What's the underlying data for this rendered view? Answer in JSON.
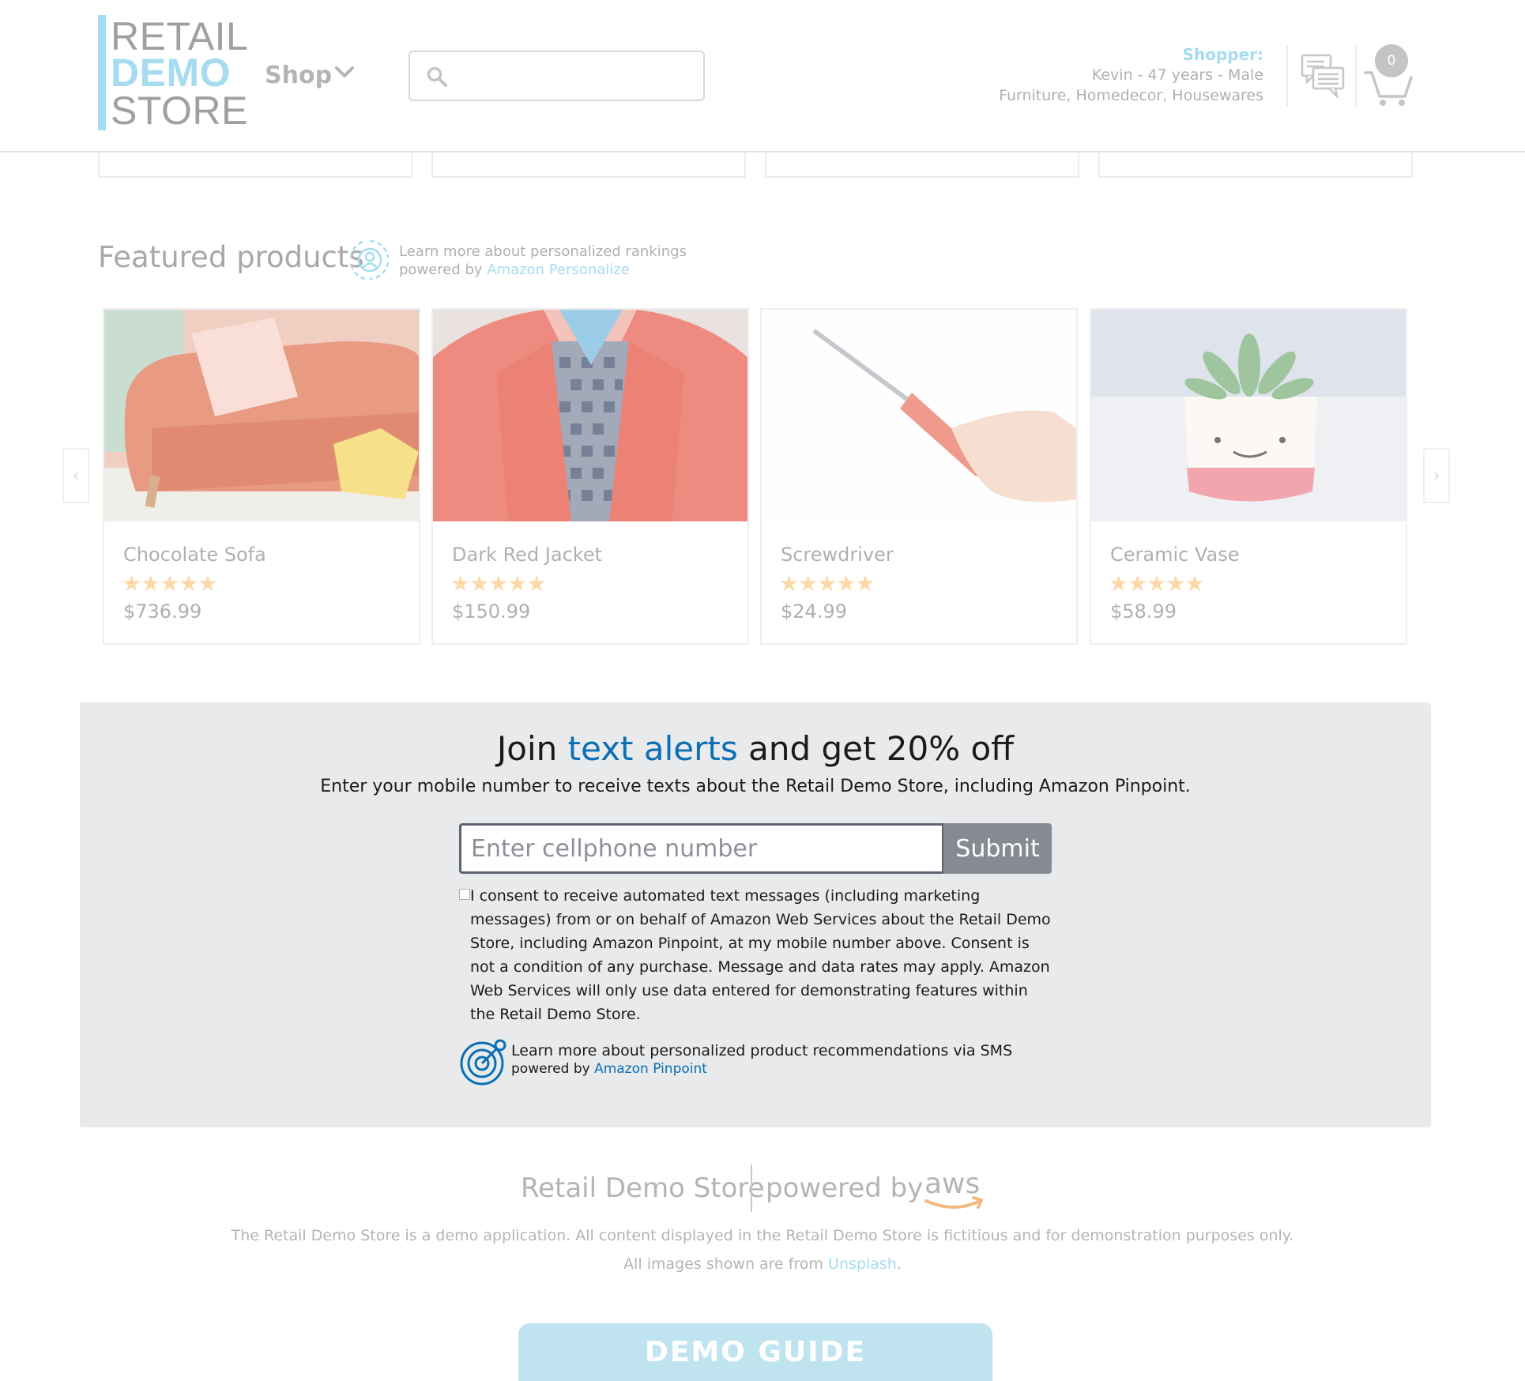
{
  "header": {
    "logo": {
      "line1": "RETAIL",
      "line2": "DEMO",
      "line3": "STORE"
    },
    "shop_label": "Shop",
    "search": {
      "placeholder": "",
      "value": ""
    },
    "shopper": {
      "label": "Shopper:",
      "profile": "Kevin - 47 years - Male",
      "interests": "Furniture, Homedecor, Housewares"
    },
    "cart_count": "0"
  },
  "featured": {
    "title": "Featured products",
    "learn_more": "Learn more about personalized rankings",
    "powered_by": "powered by",
    "service": "Amazon Personalize",
    "prev_arrow": "‹",
    "next_arrow": "›",
    "products": [
      {
        "name": "Chocolate Sofa",
        "rating": 5,
        "stars": "★★★★★",
        "price": "$736.99"
      },
      {
        "name": "Dark Red Jacket",
        "rating": 5,
        "stars": "★★★★★",
        "price": "$150.99"
      },
      {
        "name": "Screwdriver",
        "rating": 5,
        "stars": "★★★★★",
        "price": "$24.99"
      },
      {
        "name": "Ceramic Vase",
        "rating": 5,
        "stars": "★★★★★",
        "price": "$58.99"
      }
    ]
  },
  "alerts": {
    "heading_pre": "Join ",
    "heading_highlight": "text alerts",
    "heading_post": " and get 20% off",
    "subtitle": "Enter your mobile number to receive texts about the Retail Demo Store, including Amazon Pinpoint.",
    "phone_placeholder": "Enter cellphone number",
    "submit_label": "Submit",
    "consent_text": "I consent to receive automated text messages (including marketing messages) from or on behalf of Amazon Web Services about the Retail Demo Store, including Amazon Pinpoint, at my mobile number above. Consent is not a condition of any purchase. Message and data rates may apply. Amazon Web Services will only use data entered for demonstrating features within the Retail Demo Store.",
    "learn_more": "Learn more about personalized product recommendations via SMS",
    "powered_by": "powered by",
    "service": "Amazon Pinpoint"
  },
  "footer": {
    "brand": "Retail Demo Store",
    "powered_by": "powered by",
    "aws": "aws",
    "disclaimer": "The Retail Demo Store is a demo application. All content displayed in the Retail Demo Store is fictitious and for demonstration purposes only.",
    "images_pre": "All images shown are from ",
    "images_link": "Unsplash",
    "images_post": "."
  },
  "demo_guide_label": "DEMO GUIDE",
  "colors": {
    "accent_light": "#a6dcef",
    "link_blue": "#0a6fb5",
    "alerts_bg": "#e9eaeb",
    "submit_bg": "#868b93",
    "star": "#fcd9a8"
  }
}
